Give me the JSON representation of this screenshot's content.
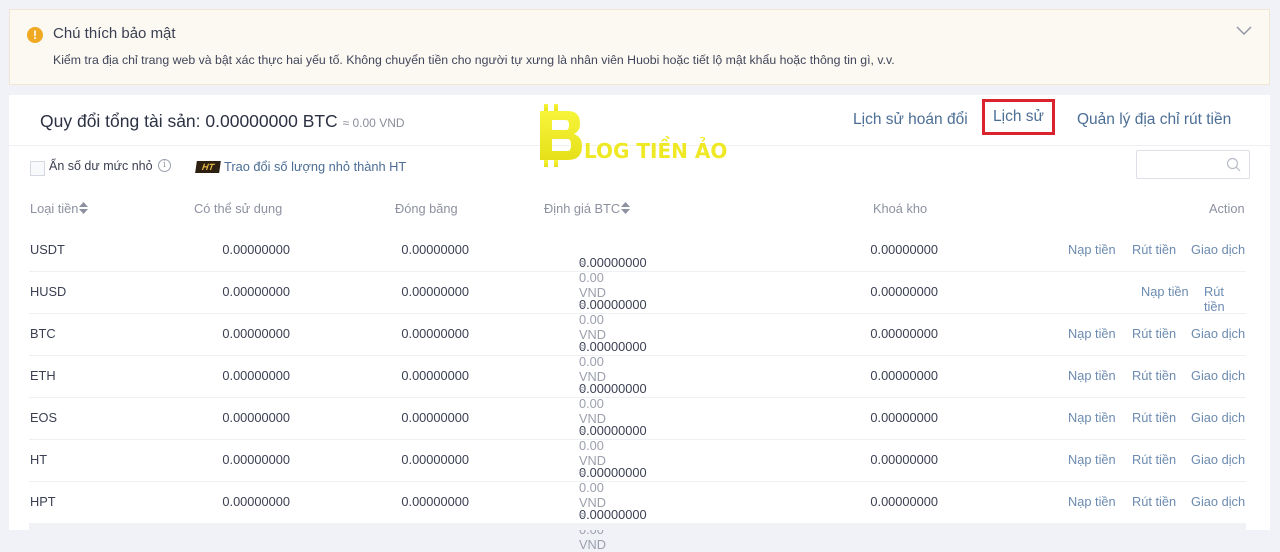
{
  "notice": {
    "icon": "warning-icon",
    "title": "Chú thích bảo mật",
    "message": "Kiểm tra địa chỉ trang web và bật xác thực hai yếu tố. Không chuyển tiền cho người tự xưng là nhân viên Huobi hoặc tiết lộ mật khẩu hoặc thông tin gì, v.v."
  },
  "summary": {
    "label": "Quy đổi tổng tài sản: 0.00000000 BTC",
    "approx": "≈ 0.00 VND"
  },
  "watermark": "BLOG TIỀN ẢO",
  "nav": {
    "swap_history": "Lịch sử hoán đổi",
    "history": "Lịch sử",
    "withdraw_address": "Quản lý địa chỉ rút tiền"
  },
  "filters": {
    "hide_small": "Ẩn số dư mức nhỏ",
    "ht_badge": "HT",
    "convert_small": "Trao đổi số lượng nhỏ thành HT",
    "search_placeholder": ""
  },
  "columns": {
    "coin": "Loại tiền",
    "available": "Có thể sử dụng",
    "frozen": "Đóng băng",
    "btc_value": "Định giá BTC",
    "locked": "Khoá kho",
    "action": "Action"
  },
  "actions": {
    "deposit": "Nạp tiền",
    "withdraw": "Rút tiền",
    "trade": "Giao dịch"
  },
  "rows": [
    {
      "coin": "USDT",
      "available": "0.00000000",
      "frozen": "0.00000000",
      "btc": "0.00000000",
      "vnd": "≈ 0.00 VND",
      "locked": "0.00000000",
      "trade": true
    },
    {
      "coin": "HUSD",
      "available": "0.00000000",
      "frozen": "0.00000000",
      "btc": "0.00000000",
      "vnd": "≈ 0.00 VND",
      "locked": "0.00000000",
      "trade": false
    },
    {
      "coin": "BTC",
      "available": "0.00000000",
      "frozen": "0.00000000",
      "btc": "0.00000000",
      "vnd": "≈ 0.00 VND",
      "locked": "0.00000000",
      "trade": true
    },
    {
      "coin": "ETH",
      "available": "0.00000000",
      "frozen": "0.00000000",
      "btc": "0.00000000",
      "vnd": "≈ 0.00 VND",
      "locked": "0.00000000",
      "trade": true
    },
    {
      "coin": "EOS",
      "available": "0.00000000",
      "frozen": "0.00000000",
      "btc": "0.00000000",
      "vnd": "≈ 0.00 VND",
      "locked": "0.00000000",
      "trade": true
    },
    {
      "coin": "HT",
      "available": "0.00000000",
      "frozen": "0.00000000",
      "btc": "0.00000000",
      "vnd": "≈ 0.00 VND",
      "locked": "0.00000000",
      "trade": true
    },
    {
      "coin": "HPT",
      "available": "0.00000000",
      "frozen": "0.00000000",
      "btc": "0.00000000",
      "vnd": "≈ 0.00 VND",
      "locked": "0.00000000",
      "trade": true
    }
  ]
}
